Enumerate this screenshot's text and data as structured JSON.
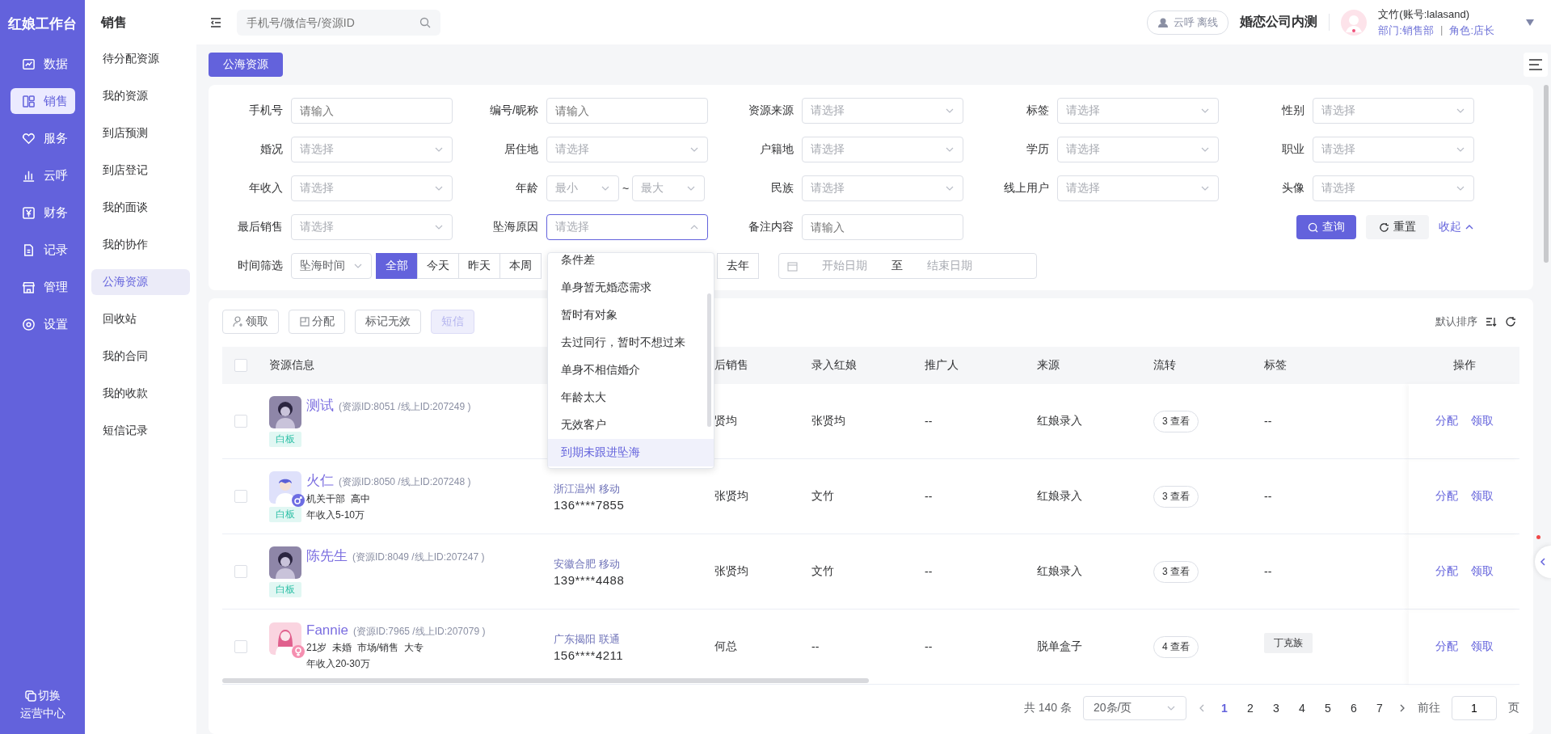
{
  "brand": "红娘工作台",
  "nav": [
    {
      "label": "数据",
      "selected": false
    },
    {
      "label": "销售",
      "selected": true
    },
    {
      "label": "服务",
      "selected": false
    },
    {
      "label": "云呼",
      "selected": false
    },
    {
      "label": "财务",
      "selected": false
    },
    {
      "label": "记录",
      "selected": false
    },
    {
      "label": "管理",
      "selected": false
    },
    {
      "label": "设置",
      "selected": false
    }
  ],
  "switch": {
    "label": "切换",
    "sub": "运营中心"
  },
  "subnav": {
    "title": "销售",
    "items": [
      {
        "label": "待分配资源",
        "selected": false
      },
      {
        "label": "我的资源",
        "selected": false
      },
      {
        "label": "到店预测",
        "selected": false
      },
      {
        "label": "到店登记",
        "selected": false
      },
      {
        "label": "我的面谈",
        "selected": false
      },
      {
        "label": "我的协作",
        "selected": false
      },
      {
        "label": "公海资源",
        "selected": true
      },
      {
        "label": "回收站",
        "selected": false
      },
      {
        "label": "我的合同",
        "selected": false
      },
      {
        "label": "我的收款",
        "selected": false
      },
      {
        "label": "短信记录",
        "selected": false
      }
    ]
  },
  "header": {
    "search_placeholder": "手机号/微信号/资源ID",
    "call_status": "云呼 离线",
    "company": "婚恋公司内测",
    "user": "文竹(账号:lalasand)",
    "dept": "部门:销售部",
    "separator": "|",
    "role": "角色:店长"
  },
  "page_tab": "公海资源",
  "filters": [
    {
      "label": "手机号",
      "kind": "input",
      "placeholder": "请输入"
    },
    {
      "label": "编号/昵称",
      "kind": "input",
      "placeholder": "请输入"
    },
    {
      "label": "资源来源",
      "kind": "select",
      "placeholder": "请选择"
    },
    {
      "label": "标签",
      "kind": "select",
      "placeholder": "请选择"
    },
    {
      "label": "性别",
      "kind": "select",
      "placeholder": "请选择"
    },
    {
      "label": "婚况",
      "kind": "select",
      "placeholder": "请选择"
    },
    {
      "label": "居住地",
      "kind": "select",
      "placeholder": "请选择"
    },
    {
      "label": "户籍地",
      "kind": "select",
      "placeholder": "请选择"
    },
    {
      "label": "学历",
      "kind": "select",
      "placeholder": "请选择"
    },
    {
      "label": "职业",
      "kind": "select",
      "placeholder": "请选择"
    },
    {
      "label": "年收入",
      "kind": "select",
      "placeholder": "请选择"
    },
    {
      "label": "年龄",
      "kind": "range",
      "min": "最小",
      "separator": "~",
      "max": "最大"
    },
    {
      "label": "民族",
      "kind": "select",
      "placeholder": "请选择"
    },
    {
      "label": "线上用户",
      "kind": "select",
      "placeholder": "请选择"
    },
    {
      "label": "头像",
      "kind": "select",
      "placeholder": "请选择"
    },
    {
      "label": "最后销售",
      "kind": "select",
      "placeholder": "请选择"
    },
    {
      "label": "坠海原因",
      "kind": "select",
      "placeholder": "请选择",
      "open": true
    },
    {
      "label": "备注内容",
      "kind": "input",
      "placeholder": "请输入"
    }
  ],
  "actions": {
    "query": "查询",
    "reset": "重置",
    "collapse": "收起"
  },
  "time_filter": {
    "label": "时间筛选",
    "field": "坠海时间",
    "periods": [
      {
        "label": "全部",
        "selected": true
      },
      {
        "label": "今天",
        "selected": false
      },
      {
        "label": "昨天",
        "selected": false
      },
      {
        "label": "本周",
        "selected": false
      },
      {
        "label": "去年",
        "selected": false
      }
    ],
    "start": "开始日期",
    "to": "至",
    "end": "结束日期"
  },
  "dropdown": {
    "options": [
      {
        "label": "条件差",
        "selected": false
      },
      {
        "label": "单身暂无婚恋需求",
        "selected": false
      },
      {
        "label": "暂时有对象",
        "selected": false
      },
      {
        "label": "去过同行，暂时不想过来",
        "selected": false
      },
      {
        "label": "单身不相信婚介",
        "selected": false
      },
      {
        "label": "年龄太大",
        "selected": false
      },
      {
        "label": "无效客户",
        "selected": false
      },
      {
        "label": "到期未跟进坠海",
        "selected": true
      }
    ]
  },
  "toolbar": {
    "buttons": [
      {
        "label": "领取",
        "disabled": false
      },
      {
        "label": "分配",
        "disabled": false
      },
      {
        "label": "标记无效",
        "disabled": false
      },
      {
        "label": "短信",
        "disabled": true
      }
    ],
    "sort": "默认排序"
  },
  "table": {
    "all_checked": false,
    "columns": [
      "资源信息",
      "后销售",
      "录入红娘",
      "推广人",
      "来源",
      "流转",
      "标签",
      "操作"
    ],
    "rows": [
      {
        "kind": "unknown",
        "checked": false,
        "name": "测试",
        "ids": "(资源ID:8051 /线上ID:207249 )",
        "details": [],
        "board_tag": "白板",
        "last_sales": "贤均",
        "entered_by": "张贤均",
        "promoter": "--",
        "source": "红娘录入",
        "flow": "3 查看",
        "tags": [],
        "no_tag": "--",
        "actions": [
          "分配",
          "领取"
        ]
      },
      {
        "kind": "male",
        "checked": false,
        "name": "火仁",
        "ids": "(资源ID:8050 /线上ID:207248 )",
        "details": [
          "机关干部  高中",
          "年收入5-10万"
        ],
        "board_tag": "白板",
        "region": "浙江温州 移动",
        "phone": "136****7855",
        "last_sales": "张贤均",
        "entered_by": "文竹",
        "promoter": "--",
        "source": "红娘录入",
        "flow": "3 查看",
        "tags": [],
        "no_tag": "--",
        "actions": [
          "分配",
          "领取"
        ]
      },
      {
        "kind": "unknown",
        "checked": false,
        "name": "陈先生",
        "ids": "(资源ID:8049 /线上ID:207247 )",
        "details": [],
        "board_tag": "白板",
        "region": "安徽合肥 移动",
        "phone": "139****4488",
        "last_sales": "张贤均",
        "entered_by": "文竹",
        "promoter": "--",
        "source": "红娘录入",
        "flow": "3 查看",
        "tags": [],
        "no_tag": "--",
        "actions": [
          "分配",
          "领取"
        ]
      },
      {
        "kind": "female",
        "checked": false,
        "name": "Fannie",
        "ids": "(资源ID:7965 /线上ID:207079 )",
        "details": [
          "21岁  未婚  市场/销售  大专",
          "年收入20-30万"
        ],
        "region": "广东揭阳 联通",
        "phone": "156****4211",
        "last_sales": "何总",
        "entered_by": "--",
        "promoter": "--",
        "source": "脱单盒子",
        "flow": "4 查看",
        "tags": [
          "丁克族"
        ],
        "actions": [
          "分配",
          "领取"
        ]
      }
    ]
  },
  "pagination": {
    "total": "共 140 条",
    "page_size": "20条/页",
    "pages": [
      {
        "label": "1",
        "selected": true
      },
      {
        "label": "2",
        "selected": false
      },
      {
        "label": "3",
        "selected": false
      },
      {
        "label": "4",
        "selected": false
      },
      {
        "label": "5",
        "selected": false
      },
      {
        "label": "6",
        "selected": false
      },
      {
        "label": "7",
        "selected": false
      }
    ],
    "goto": "前往",
    "goto_value": "1",
    "unit": "页"
  }
}
